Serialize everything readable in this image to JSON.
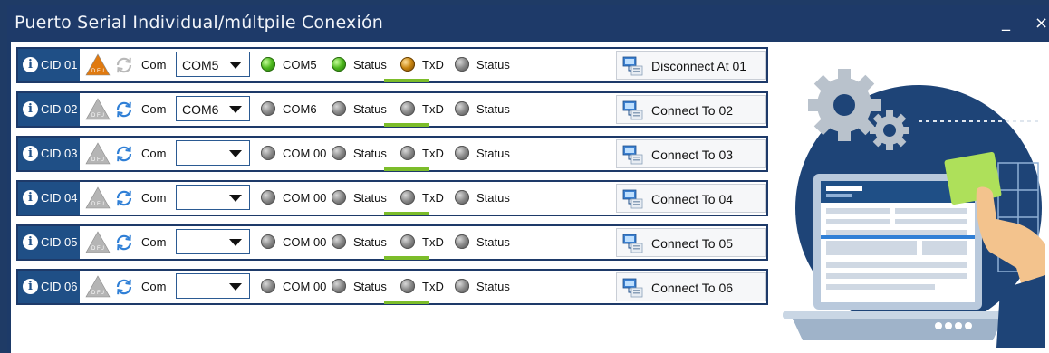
{
  "window": {
    "title": "Puerto Serial Individual/múltpile Conexión",
    "minimize": "_",
    "close": "×"
  },
  "rows": [
    {
      "cid": "CID 01",
      "dfu": "D FU",
      "com_label": "Com",
      "combo_value": "COM5",
      "port": "COM5",
      "status1": "Status",
      "txd": "TxD",
      "status2": "Status",
      "connect": "Disconnect At 01",
      "port_led": "green",
      "status_led": "green",
      "txd_led": "orange",
      "status2_led": "gray",
      "warn_color": "#e07a10",
      "sync_color": "#b8b8b8"
    },
    {
      "cid": "CID 02",
      "dfu": "D FU",
      "com_label": "Com",
      "combo_value": "COM6",
      "port": "COM6",
      "status1": "Status",
      "txd": "TxD",
      "status2": "Status",
      "connect": "Connect To 02",
      "port_led": "gray",
      "status_led": "gray",
      "txd_led": "gray",
      "status2_led": "gray",
      "warn_color": "#b5b5b5",
      "sync_color": "#2f7fd6"
    },
    {
      "cid": "CID 03",
      "dfu": "D FU",
      "com_label": "Com",
      "combo_value": "",
      "port": "COM 00",
      "status1": "Status",
      "txd": "TxD",
      "status2": "Status",
      "connect": "Connect To 03",
      "port_led": "gray",
      "status_led": "gray",
      "txd_led": "gray",
      "status2_led": "gray",
      "warn_color": "#b5b5b5",
      "sync_color": "#2f7fd6"
    },
    {
      "cid": "CID 04",
      "dfu": "D FU",
      "com_label": "Com",
      "combo_value": "",
      "port": "COM 00",
      "status1": "Status",
      "txd": "TxD",
      "status2": "Status",
      "connect": "Connect To 04",
      "port_led": "gray",
      "status_led": "gray",
      "txd_led": "gray",
      "status2_led": "gray",
      "warn_color": "#b5b5b5",
      "sync_color": "#2f7fd6"
    },
    {
      "cid": "CID 05",
      "dfu": "D FU",
      "com_label": "Com",
      "combo_value": "",
      "port": "COM 00",
      "status1": "Status",
      "txd": "TxD",
      "status2": "Status",
      "connect": "Connect To 05",
      "port_led": "gray",
      "status_led": "gray",
      "txd_led": "gray",
      "status2_led": "gray",
      "warn_color": "#b5b5b5",
      "sync_color": "#2f7fd6"
    },
    {
      "cid": "CID 06",
      "dfu": "D FU",
      "com_label": "Com",
      "combo_value": "",
      "port": "COM 00",
      "status1": "Status",
      "txd": "TxD",
      "status2": "Status",
      "connect": "Connect To 06",
      "port_led": "gray",
      "status_led": "gray",
      "txd_led": "gray",
      "status2_led": "gray",
      "warn_color": "#b5b5b5",
      "sync_color": "#2f7fd6"
    }
  ],
  "icons": {
    "info": "info-icon",
    "warning": "dfu-warning-icon",
    "sync": "refresh-icon",
    "dropdown": "chevron-down-icon",
    "connection": "network-computer-icon",
    "illustration": "laptop-gears-illustration"
  },
  "colors": {
    "titlebar": "#1e3a69",
    "cid_bg": "#1f4f86",
    "txd_bar": "#7cbd2a"
  }
}
